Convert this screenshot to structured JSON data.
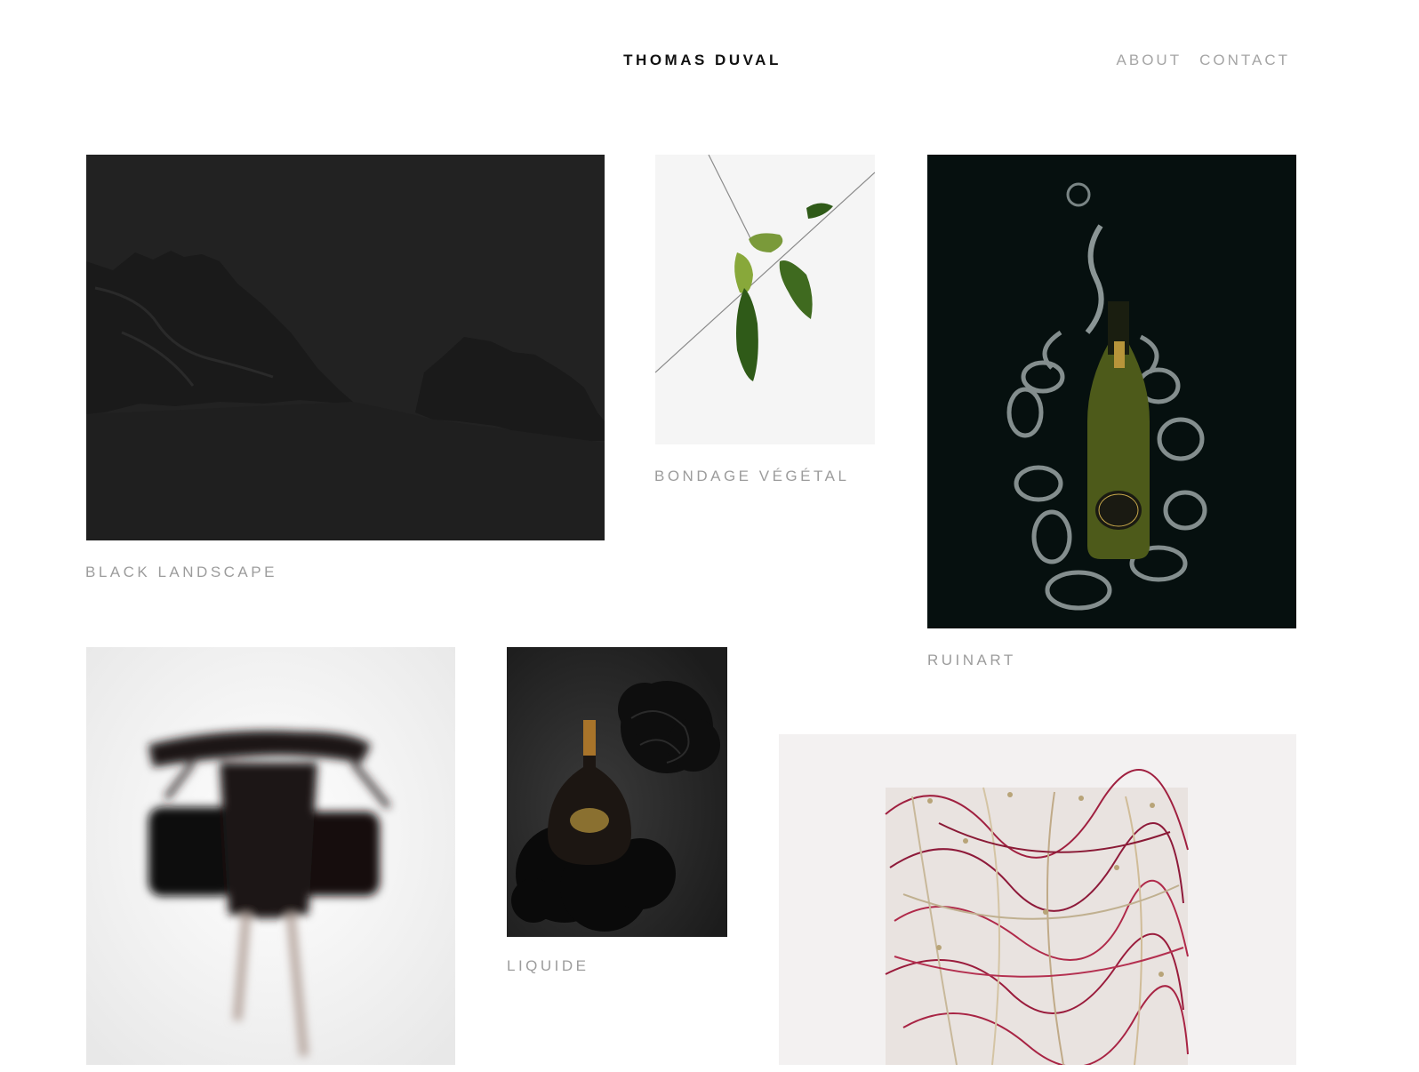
{
  "header": {
    "site_title": "THOMAS DUVAL",
    "nav": {
      "about": "ABOUT",
      "contact": "CONTACT"
    }
  },
  "projects": [
    {
      "title": "BLACK LANDSCAPE",
      "image": "dark-snowy-mountains"
    },
    {
      "title": "BONDAGE VÉGÉTAL",
      "image": "green-leaves-tied-on-string"
    },
    {
      "title": "RUINART",
      "image": "champagne-bottle-with-glass-swirls"
    },
    {
      "title": "",
      "image": "blurred-dancing-figure"
    },
    {
      "title": "LIQUIDE",
      "image": "cognac-bottle-with-black-flowers"
    },
    {
      "title": "",
      "image": "tangle-of-red-sprouts"
    }
  ],
  "colors": {
    "title": "#111111",
    "nav": "#a5a5a5",
    "caption": "#9c9c9c"
  }
}
